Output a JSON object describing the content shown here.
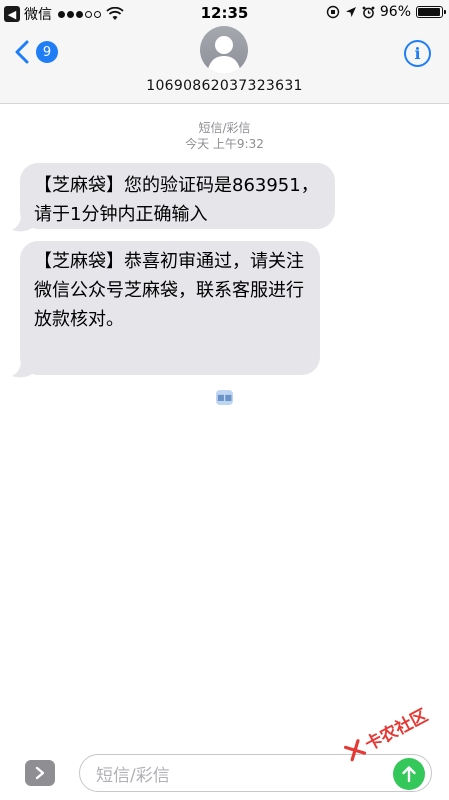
{
  "status_bar": {
    "back_app": "微信",
    "time": "12:35",
    "battery": "96%",
    "battery_level": 0.96
  },
  "header": {
    "unread_count": "9",
    "contact_number": "10690862037323631"
  },
  "conversation": {
    "message_type": "短信/彩信",
    "timestamp": "今天 上午9:32",
    "messages": [
      {
        "text": "【芝麻袋】您的验证码是863951，请于1分钟内正确输入"
      },
      {
        "text": "【芝麻袋】恭喜初审通过，请关注微信公众号芝麻袋，联系客服进行放款核对。"
      }
    ]
  },
  "input_bar": {
    "placeholder": "短信/彩信"
  },
  "watermark": {
    "text": "卡农社区"
  }
}
